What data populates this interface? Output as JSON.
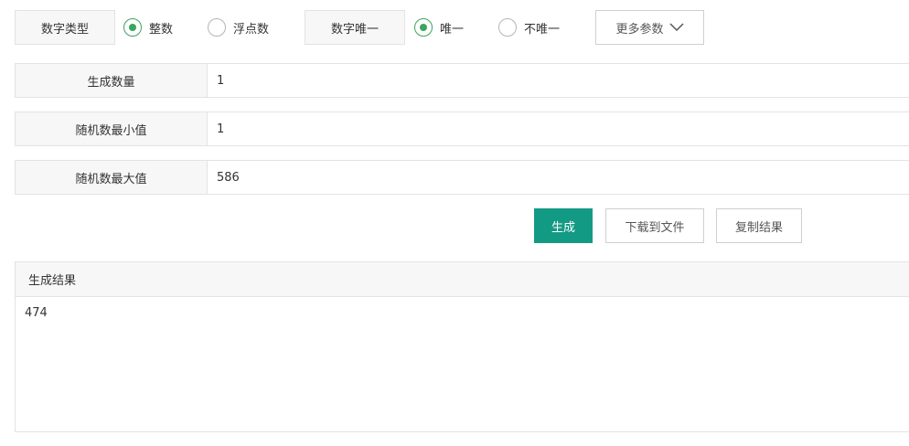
{
  "number_type": {
    "label": "数字类型",
    "options": [
      {
        "label": "整数",
        "checked": true
      },
      {
        "label": "浮点数",
        "checked": false
      }
    ]
  },
  "unique": {
    "label": "数字唯一",
    "options": [
      {
        "label": "唯一",
        "checked": true
      },
      {
        "label": "不唯一",
        "checked": false
      }
    ]
  },
  "more_params": {
    "label": "更多参数",
    "icon": "chevron-down-icon"
  },
  "fields": {
    "count": {
      "label": "生成数量",
      "value": "1"
    },
    "min": {
      "label": "随机数最小值",
      "value": "1"
    },
    "max": {
      "label": "随机数最大值",
      "value": "586"
    }
  },
  "actions": {
    "generate": "生成",
    "download": "下载到文件",
    "copy": "复制结果"
  },
  "result": {
    "title": "生成结果",
    "value": "474"
  },
  "colors": {
    "accent": "#139a84",
    "radio_checked": "#3aa55c",
    "label_bg": "#f7f7f7",
    "border": "#e3e3e3"
  }
}
